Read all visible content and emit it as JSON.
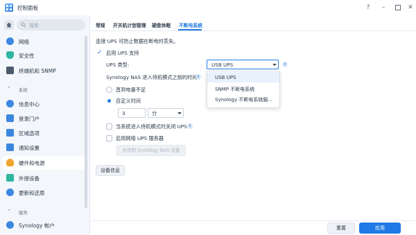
{
  "window": {
    "title": "控制面板"
  },
  "search": {
    "placeholder": "搜索"
  },
  "sidebar": {
    "items_top": [
      {
        "label": "网络",
        "icon": "network-icon",
        "color": "#3b87e0"
      },
      {
        "label": "安全性",
        "icon": "shield-icon",
        "color": "#2fb6a0"
      },
      {
        "label": "终端机和 SNMP",
        "icon": "terminal-icon",
        "color": "#4b5b6e"
      }
    ],
    "section_system": "系统",
    "items_system": [
      {
        "label": "信息中心",
        "icon": "info-center-icon",
        "color": "#3b87e0"
      },
      {
        "label": "登录门户",
        "icon": "login-portal-icon",
        "color": "#3b87e0"
      },
      {
        "label": "区域选项",
        "icon": "region-icon",
        "color": "#3b87e0"
      },
      {
        "label": "通知设置",
        "icon": "notification-icon",
        "color": "#3b87e0"
      },
      {
        "label": "硬件和电源",
        "icon": "lightbulb-icon",
        "color": "#f0a531"
      },
      {
        "label": "外接设备",
        "icon": "external-device-icon",
        "color": "#2fb6a0"
      },
      {
        "label": "更新和还原",
        "icon": "update-icon",
        "color": "#3b87e0"
      }
    ],
    "section_services": "服务",
    "items_services": [
      {
        "label": "Synology 帐户",
        "icon": "synology-account-icon",
        "color": "#3b87e0"
      }
    ]
  },
  "tabs": [
    "常规",
    "开关机计划管理",
    "硬盘休眠",
    "不断电系统"
  ],
  "content": {
    "description": "连接 UPS 可防止数据在断电时丢失。",
    "enable_ups": "启用 UPS 支持",
    "ups_type_label": "UPS 类型:",
    "ups_type_value": "USB UPS",
    "standby_label": "Synology NAS 进入待机模式之前的时间",
    "option_low_battery": "直到电量不足",
    "option_custom": "自定义时间",
    "time_value": "3",
    "time_unit": "分",
    "shutdown_ups_label": "当系统进入待机模式时关闭 UPS",
    "network_ups_label": "启用网络 UPS 服务器",
    "allowed_devices_button": "允许的 Synology NAS 设备",
    "device_info_button": "设备信息"
  },
  "dropdown": {
    "options": [
      "USB UPS",
      "SNMP 不断电系统",
      "Synology 不断电系统服..."
    ]
  },
  "footer": {
    "reset": "重置",
    "apply": "应用"
  },
  "colors": {
    "accent": "#1f7ae5",
    "sidebar_bg": "#f3f6fa"
  }
}
